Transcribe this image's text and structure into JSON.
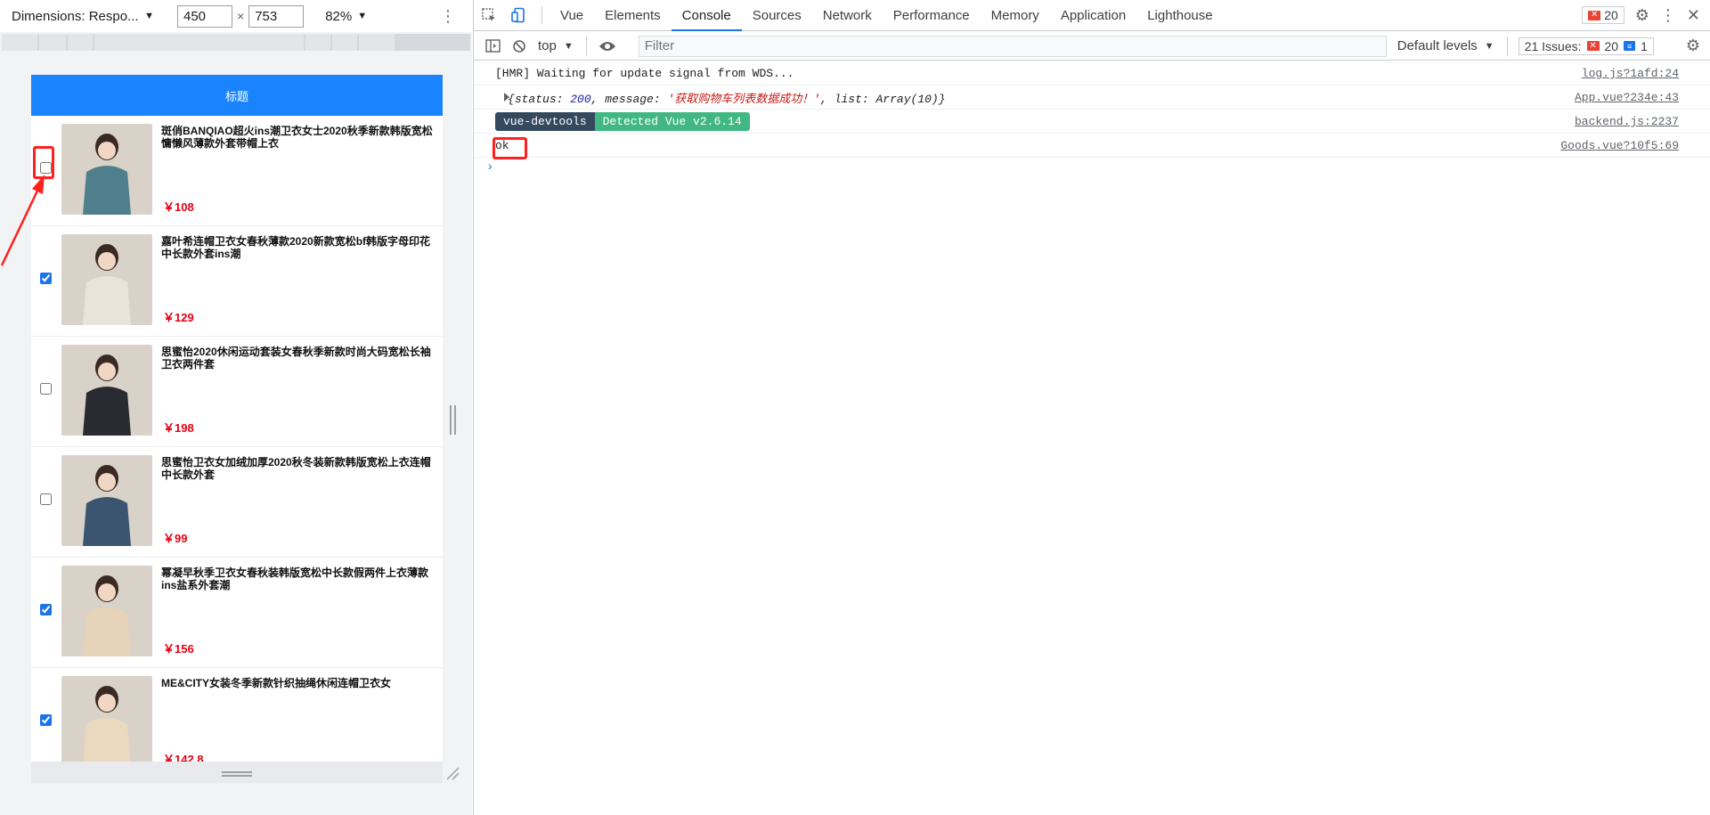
{
  "device_toolbar": {
    "dimensions_label": "Dimensions: Respo...",
    "width": "450",
    "times": "×",
    "height": "753",
    "zoom": "82%"
  },
  "app": {
    "header_title": "标题",
    "goods": [
      {
        "title": "斑俏BANQIAO超火ins潮卫衣女士2020秋季新款韩版宽松慵懒风薄款外套带帽上衣",
        "price": "￥108",
        "checked": false,
        "color": "#4f7f8c"
      },
      {
        "title": "嘉叶希连帽卫衣女春秋薄款2020新款宽松bf韩版字母印花中长款外套ins潮",
        "price": "￥129",
        "checked": true,
        "color": "#e9e4da"
      },
      {
        "title": "思蜜怡2020休闲运动套装女春秋季新款时尚大码宽松长袖卫衣两件套",
        "price": "￥198",
        "checked": false,
        "color": "#2a2a33"
      },
      {
        "title": "思蜜怡卫衣女加绒加厚2020秋冬装新款韩版宽松上衣连帽中长款外套",
        "price": "￥99",
        "checked": false,
        "color": "#3b5570"
      },
      {
        "title": "幂凝早秋季卫衣女春秋装韩版宽松中长款假两件上衣薄款ins盐系外套潮",
        "price": "￥156",
        "checked": true,
        "color": "#e6d3b8"
      },
      {
        "title": "ME&CITY女装冬季新款针织抽绳休闲连帽卫衣女",
        "price": "￥142.8",
        "checked": true,
        "color": "#ead8bf"
      }
    ]
  },
  "devtools": {
    "tabs": [
      "Vue",
      "Elements",
      "Console",
      "Sources",
      "Network",
      "Performance",
      "Memory",
      "Application",
      "Lighthouse"
    ],
    "active_tab": "Console",
    "error_count": "20",
    "context": "top",
    "filter_placeholder": "Filter",
    "levels": "Default levels",
    "issues_label": "21 Issues:",
    "issues_errors": "20",
    "issues_info": "1",
    "logs": {
      "hmr": {
        "text": "[HMR] Waiting for update signal from WDS...",
        "source": "log.js?1afd:24"
      },
      "obj": {
        "open": "{",
        "status_key": "status: ",
        "status_val": "200",
        "sep1": ", ",
        "message_key": "message: ",
        "message_val": "'获取购物车列表数据成功！'",
        "sep2": ", ",
        "list_key": "list: ",
        "list_val": "Array(10)",
        "close": "}",
        "source": "App.vue?234e:43"
      },
      "vue": {
        "badge1": "vue-devtools",
        "badge2": "Detected Vue v2.6.14",
        "source": "backend.js:2237"
      },
      "ok": {
        "text": "ok",
        "source": "Goods.vue?10f5:69"
      }
    },
    "prompt": "›"
  },
  "colors": {
    "header_blue": "#1a84ff",
    "price_red": "#e60012",
    "highlight_red": "#ff2020",
    "devtools_accent": "#1a73e8"
  }
}
